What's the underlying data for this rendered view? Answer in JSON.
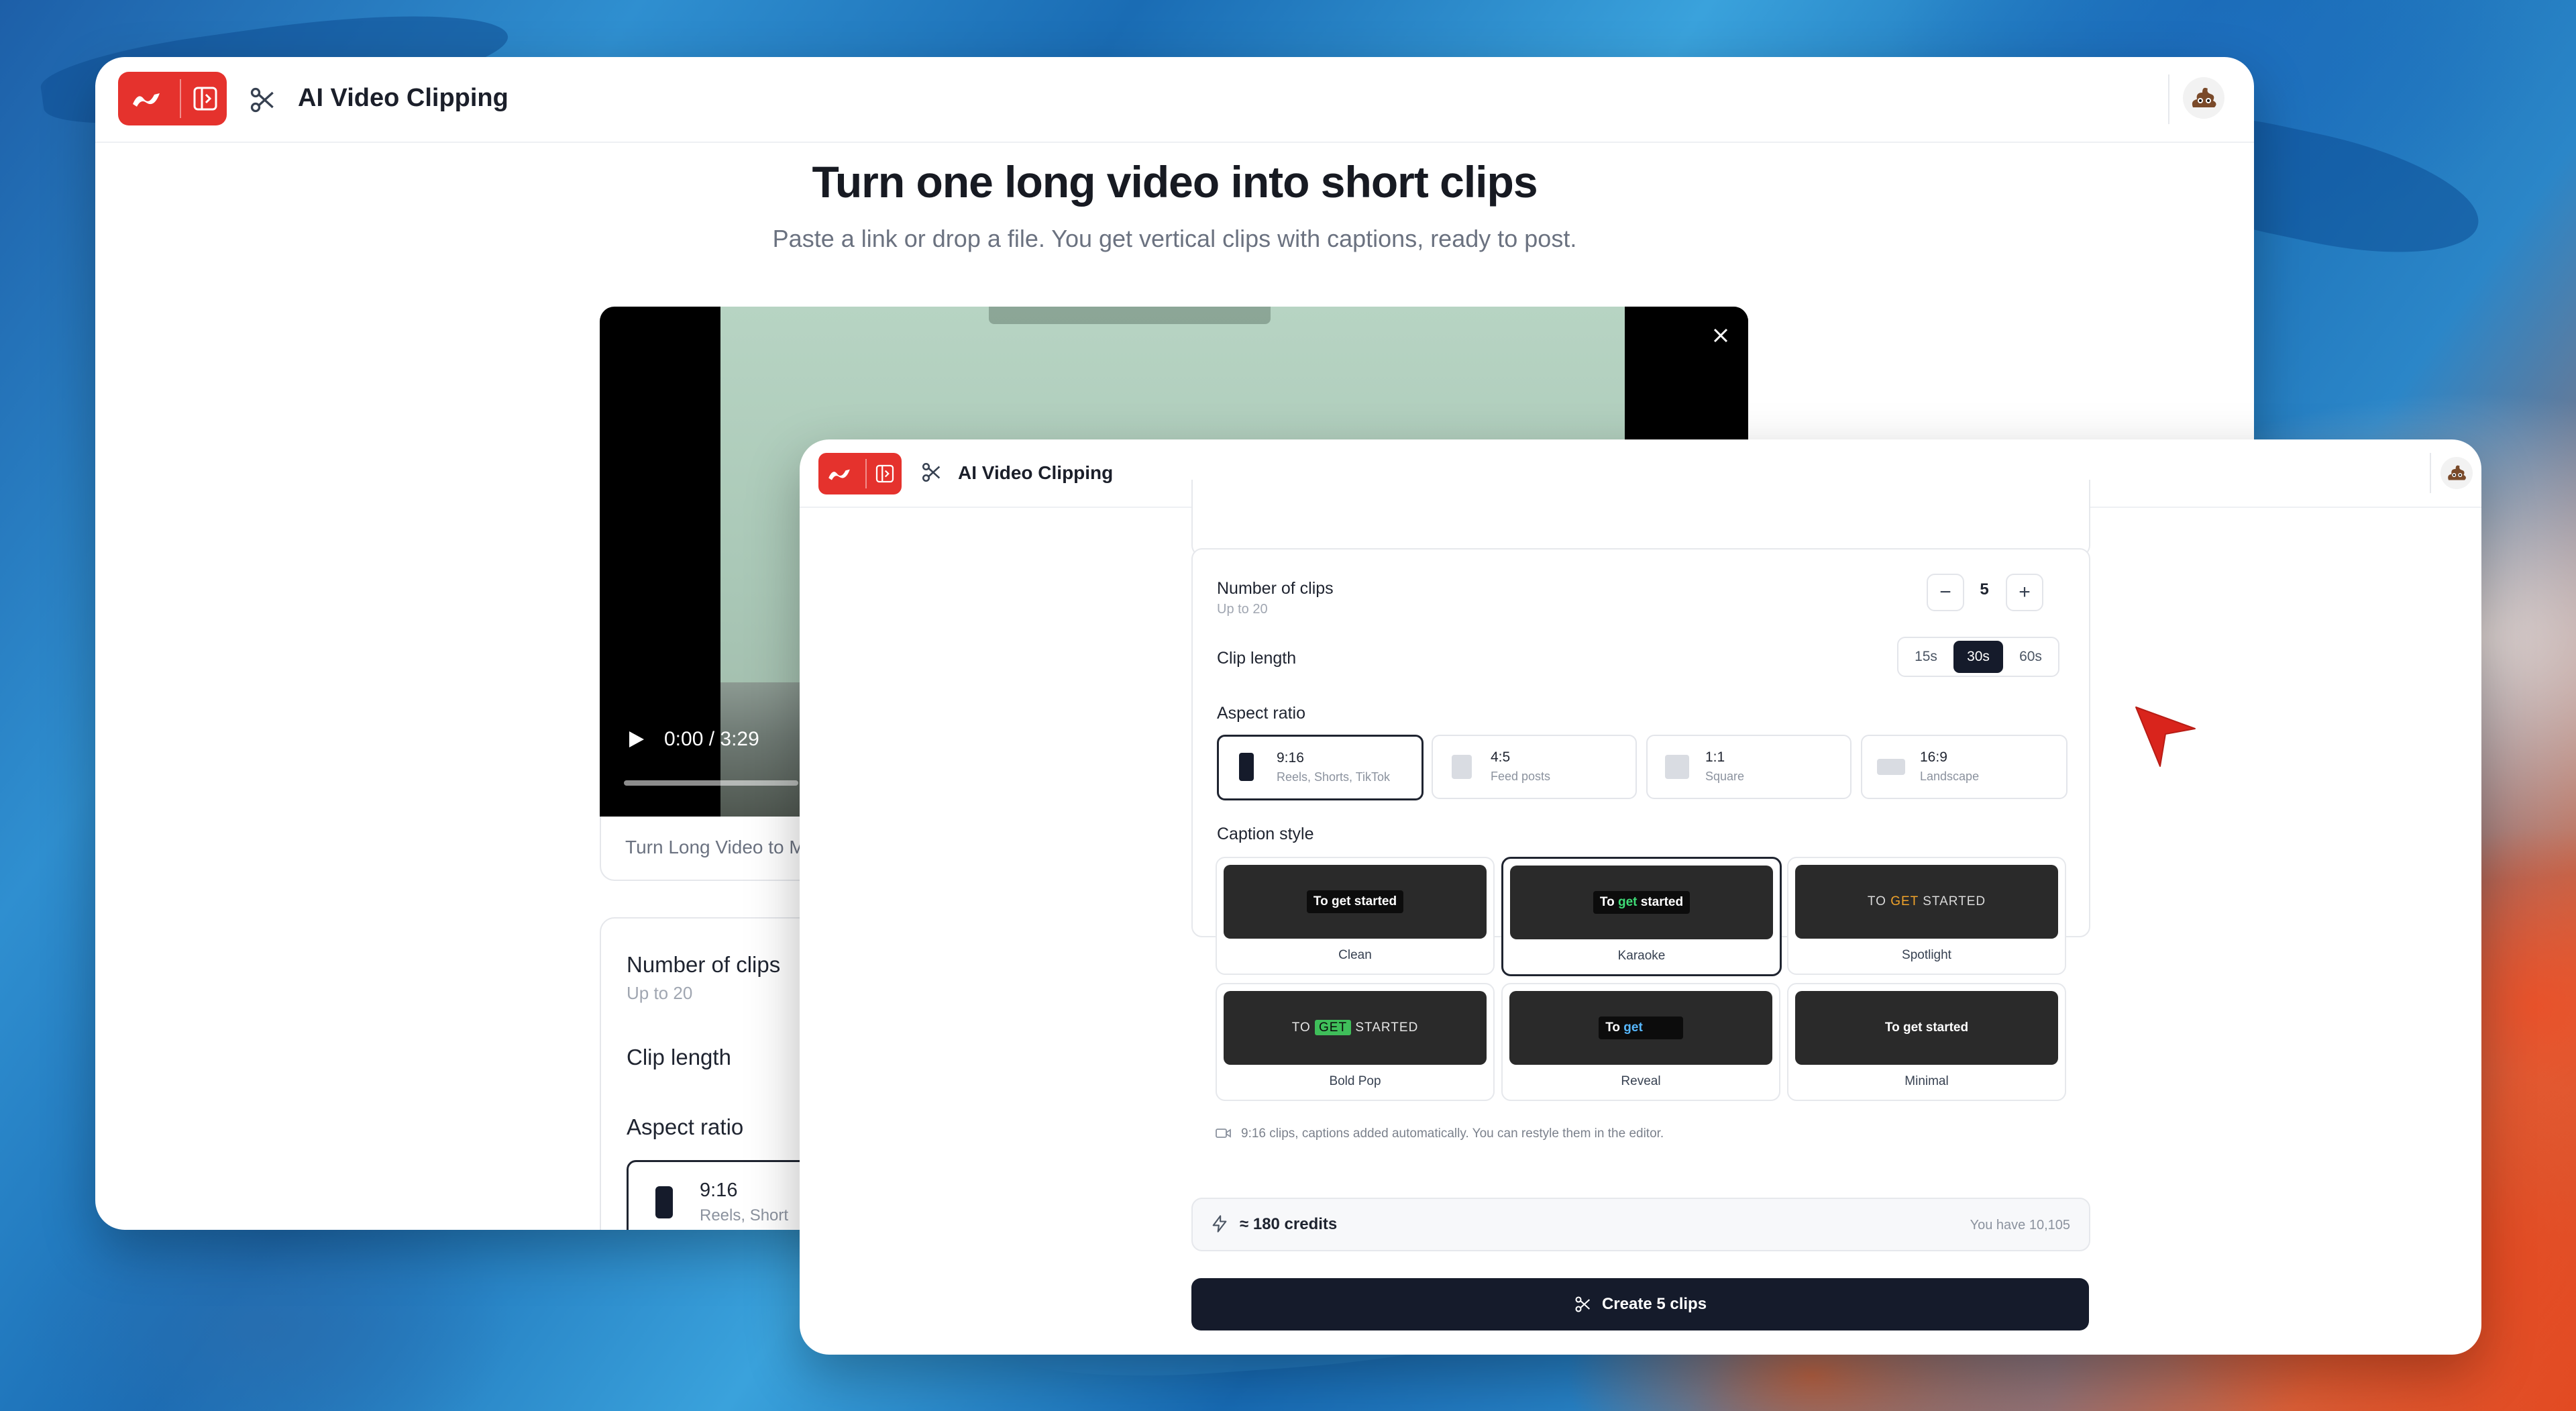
{
  "app": {
    "title": "AI Video Clipping"
  },
  "hero": {
    "title": "Turn one long video into short clips",
    "subtitle": "Paste a link or drop a file. You get vertical clips with captions, ready to post."
  },
  "video": {
    "time": "0:00 / 3:29",
    "caption": "Turn Long Video to M"
  },
  "back_settings": {
    "clips_label": "Number of clips",
    "clips_hint": "Up to 20",
    "length_label": "Clip length",
    "ratio_label": "Aspect ratio",
    "ratio_first": {
      "value": "9:16",
      "desc": "Reels, Short"
    }
  },
  "settings": {
    "clips": {
      "label": "Number of clips",
      "hint": "Up to 20",
      "value": "5",
      "minus": "−",
      "plus": "+"
    },
    "length": {
      "label": "Clip length",
      "options": [
        "15s",
        "30s",
        "60s"
      ],
      "selected": "30s"
    },
    "aspect": {
      "label": "Aspect ratio",
      "options": [
        {
          "value": "9:16",
          "desc": "Reels, Shorts, TikTok"
        },
        {
          "value": "4:5",
          "desc": "Feed posts"
        },
        {
          "value": "1:1",
          "desc": "Square"
        },
        {
          "value": "16:9",
          "desc": "Landscape"
        }
      ],
      "selected": "9:16"
    },
    "caption": {
      "label": "Caption style",
      "styles": [
        {
          "name": "Clean",
          "preview": "To get started"
        },
        {
          "name": "Karaoke",
          "preview": "To get started"
        },
        {
          "name": "Spotlight",
          "preview": "TO GET STARTED"
        },
        {
          "name": "Bold Pop",
          "preview": "TO GET STARTED"
        },
        {
          "name": "Reveal",
          "preview": "To get"
        },
        {
          "name": "Minimal",
          "preview": "To get started"
        }
      ],
      "selected": "Karaoke"
    },
    "note": "9:16 clips, captions added automatically. You can restyle them in the editor."
  },
  "credits": {
    "cost": "≈ 180 credits",
    "balance": "You have 10,105"
  },
  "cta": {
    "label": "Create 5 clips"
  },
  "colors": {
    "brand": "#e5322d",
    "dark": "#151b2b",
    "accent_green": "#3fdc77"
  }
}
